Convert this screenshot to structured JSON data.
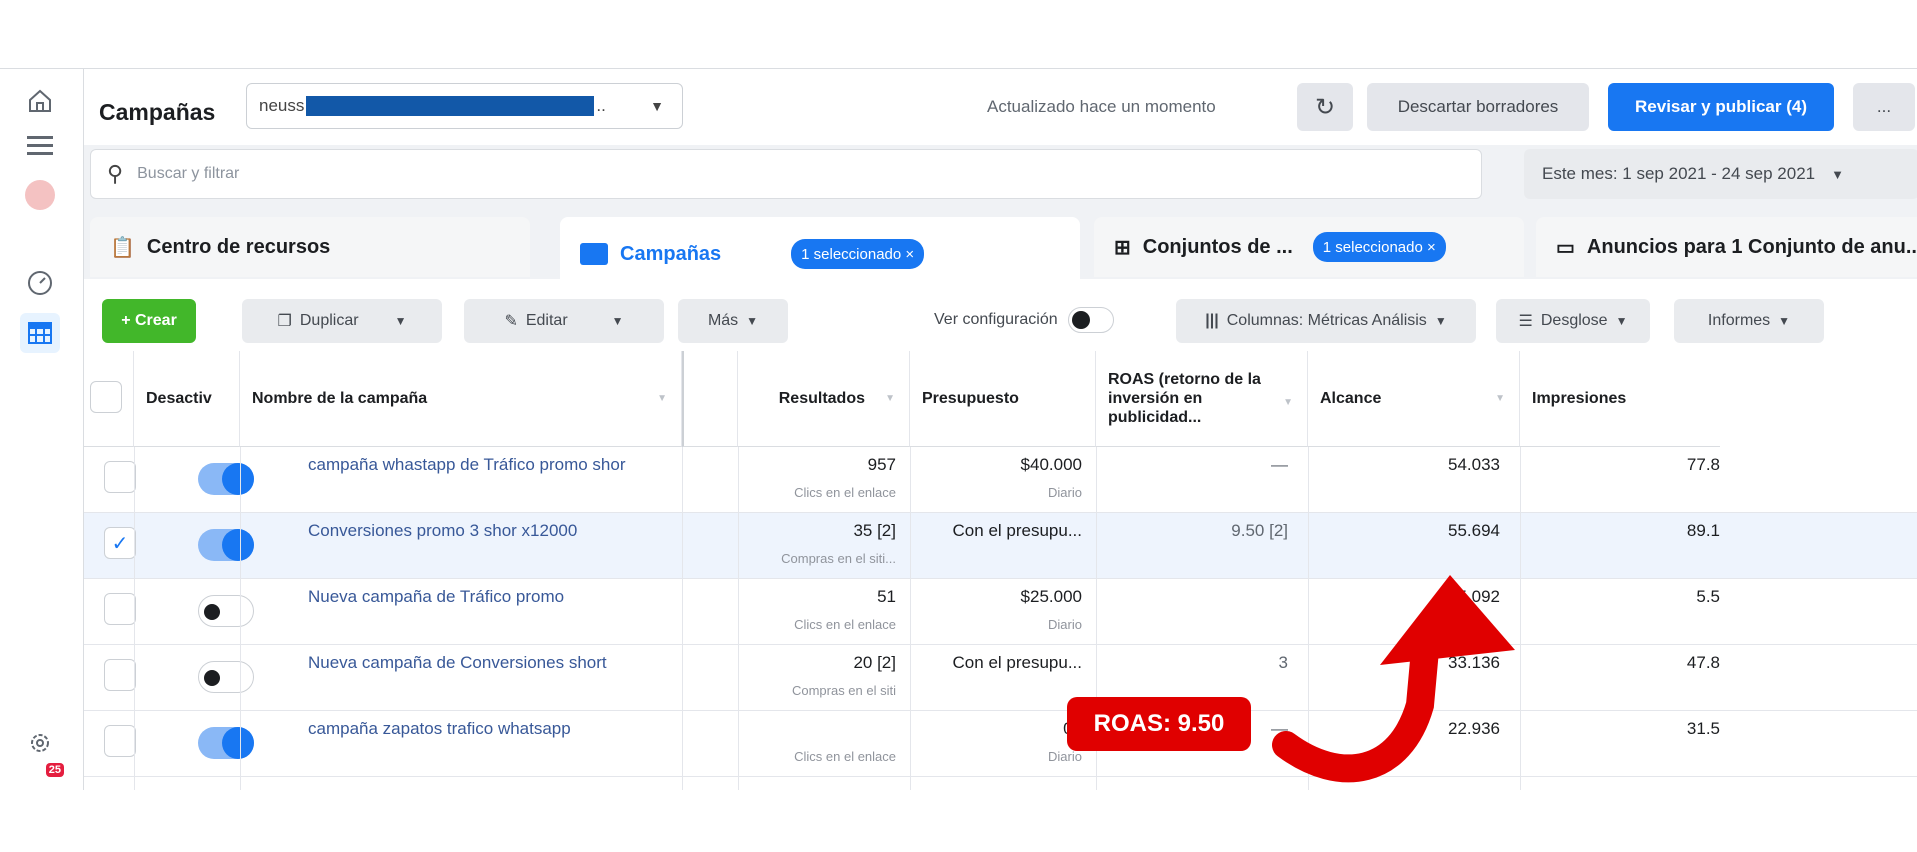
{
  "header": {
    "title": "Campañas",
    "account_prefix": "neuss",
    "account_suffix": "..",
    "updated_text": "Actualizado hace un momento",
    "discard_label": "Descartar borradores",
    "publish_label": "Revisar y publicar (4)",
    "more_label": "..."
  },
  "search": {
    "placeholder": "Buscar y filtrar",
    "date_range": "Este mes: 1 sep 2021 - 24 sep 2021"
  },
  "tabs": [
    {
      "label": "Centro de recursos"
    },
    {
      "label": "Campañas",
      "pill": "1 seleccionado ×"
    },
    {
      "label": "Conjuntos de ...",
      "pill": "1 seleccionado ×"
    },
    {
      "label": "Anuncios para 1 Conjunto de anu..."
    }
  ],
  "toolbar": {
    "create": "+ Crear",
    "duplicate": "Duplicar",
    "edit": "Editar",
    "more": "Más",
    "view_config": "Ver configuración",
    "columns": "Columnas: Métricas Análisis",
    "breakdown": "Desglose",
    "reports": "Informes"
  },
  "columns": {
    "off": "Desactiv",
    "name": "Nombre de la campaña",
    "results": "Resultados",
    "budget": "Presupuesto",
    "roas": "ROAS (retorno de la inversión en publicidad...",
    "reach": "Alcance",
    "impressions": "Impresiones"
  },
  "rows": [
    {
      "name": "campaña whastapp de Tráfico promo shor",
      "results": "957",
      "results_sub": "Clics en el enlace",
      "budget": "$40.000",
      "budget_sub": "Diario",
      "roas": "—",
      "reach": "54.033",
      "impressions": "77.8",
      "on": true,
      "checked": false
    },
    {
      "name": "Conversiones promo 3 shor x12000",
      "results": "35 [2]",
      "results_sub": "Compras en el siti...",
      "budget": "Con el presupu...",
      "budget_sub": "",
      "roas": "9.50 [2]",
      "reach": "55.694",
      "impressions": "89.1",
      "on": true,
      "checked": true
    },
    {
      "name": "Nueva campaña de Tráfico promo",
      "results": "51",
      "results_sub": "Clics en el enlace",
      "budget": "$25.000",
      "budget_sub": "Diario",
      "roas": "",
      "reach": "5.092",
      "impressions": "5.5",
      "on": false,
      "checked": false
    },
    {
      "name": "Nueva campaña de Conversiones short",
      "results": "20 [2]",
      "results_sub": "Compras en el siti",
      "budget": "Con el presupu...",
      "budget_sub": "",
      "roas": "3",
      "reach": "33.136",
      "impressions": "47.8",
      "on": false,
      "checked": false
    },
    {
      "name": "campaña zapatos trafico whatsapp",
      "results": "",
      "results_sub": "Clics en el enlace",
      "budget": "00",
      "budget_sub": "Diario",
      "roas": "—",
      "reach": "22.936",
      "impressions": "31.5",
      "on": true,
      "checked": false
    }
  ],
  "annotation": {
    "label": "ROAS: 9.50",
    "color": "#e00000"
  },
  "rail": {
    "badge": "25"
  }
}
